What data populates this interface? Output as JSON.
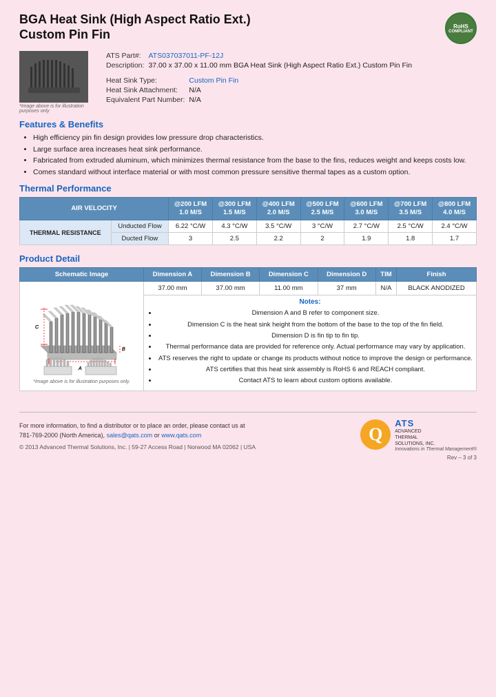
{
  "header": {
    "title_line1": "BGA Heat Sink (High Aspect Ratio Ext.)",
    "title_line2": "Custom Pin Fin",
    "rohs_line1": "RoHS",
    "rohs_line2": "COMPLIANT"
  },
  "product_info": {
    "image_caption": "*Image above is for illustration purposes only",
    "part_label": "ATS Part#:",
    "part_number": "ATS037037011-PF-12J",
    "desc_label": "Description:",
    "description": "37.00 x 37.00 x 11.00 mm BGA Heat Sink (High Aspect Ratio Ext.) Custom Pin Fin",
    "type_label": "Heat Sink Type:",
    "type_value": "Custom Pin Fin",
    "attachment_label": "Heat Sink Attachment:",
    "attachment_value": "N/A",
    "equiv_label": "Equivalent Part Number:",
    "equiv_value": "N/A"
  },
  "features": {
    "heading": "Features & Benefits",
    "items": [
      "High efficiency pin fin design provides low pressure drop characteristics.",
      "Large surface area increases heat sink performance.",
      "Fabricated from extruded aluminum, which minimizes thermal resistance from the base to the fins, reduces weight and keeps costs low.",
      "Comes standard without interface material or with most common pressure sensitive thermal tapes as a custom option."
    ]
  },
  "thermal_performance": {
    "heading": "Thermal Performance",
    "col_header": "AIR VELOCITY",
    "columns": [
      {
        "label": "@200 LFM",
        "sub": "1.0 M/S"
      },
      {
        "label": "@300 LFM",
        "sub": "1.5 M/S"
      },
      {
        "label": "@400 LFM",
        "sub": "2.0 M/S"
      },
      {
        "label": "@500 LFM",
        "sub": "2.5 M/S"
      },
      {
        "label": "@600 LFM",
        "sub": "3.0 M/S"
      },
      {
        "label": "@700 LFM",
        "sub": "3.5 M/S"
      },
      {
        "label": "@800 LFM",
        "sub": "4.0 M/S"
      }
    ],
    "row_group": "THERMAL RESISTANCE",
    "rows": [
      {
        "label": "Unducted Flow",
        "values": [
          "6.22 °C/W",
          "4.3 °C/W",
          "3.5 °C/W",
          "3 °C/W",
          "2.7 °C/W",
          "2.5 °C/W",
          "2.4 °C/W"
        ]
      },
      {
        "label": "Ducted Flow",
        "values": [
          "3",
          "2.5",
          "2.2",
          "2",
          "1.9",
          "1.8",
          "1.7"
        ]
      }
    ]
  },
  "product_detail": {
    "heading": "Product Detail",
    "columns": [
      "Schematic Image",
      "Dimension A",
      "Dimension B",
      "Dimension C",
      "Dimension D",
      "TIM",
      "Finish"
    ],
    "values": {
      "dim_a": "37.00 mm",
      "dim_b": "37.00 mm",
      "dim_c": "11.00 mm",
      "dim_d": "37 mm",
      "tim": "N/A",
      "finish": "BLACK ANODIZED"
    },
    "schematic_caption": "*Image above is for illustration purposes only.",
    "notes_heading": "Notes:",
    "notes": [
      "Dimension A and B refer to component size.",
      "Dimension C is the heat sink height from the bottom of the base to the top of the fin field.",
      "Dimension D is fin tip to fin tip.",
      "Thermal performance data are provided for reference only. Actual performance may vary by application.",
      "ATS reserves the right to update or change its products without notice to improve the design or performance.",
      "ATS certifies that this heat sink assembly is RoHS 6 and REACH compliant.",
      "Contact ATS to learn about custom options available."
    ]
  },
  "footer": {
    "contact_text": "For more information, to find a distributor or to place an order, please contact us at",
    "phone": "781-769-2000 (North America),",
    "email": "sales@qats.com",
    "or": "or",
    "website": "www.qats.com",
    "copyright": "© 2013 Advanced Thermal Solutions, Inc. | 59-27 Access Road | Norwood MA  02062 | USA",
    "page_num": "Rev – 3 of 3",
    "ats_q": "Q",
    "ats_main": "ATS",
    "ats_sub1": "ADVANCED",
    "ats_sub2": "THERMAL",
    "ats_sub3": "SOLUTIONS, INC.",
    "ats_tagline": "Innovations in Thermal Management®"
  }
}
